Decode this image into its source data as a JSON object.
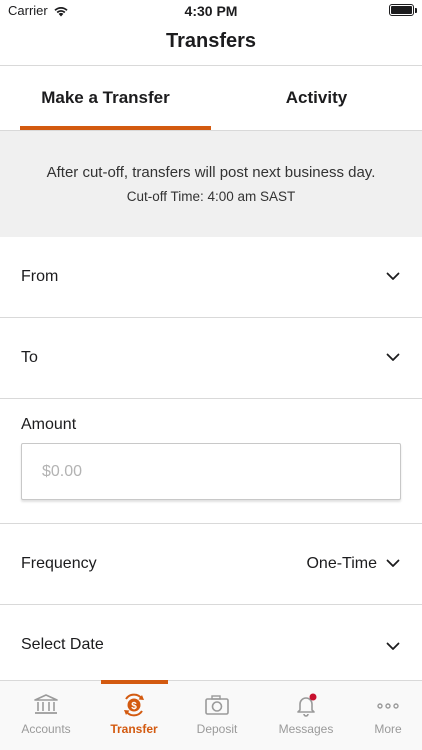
{
  "status_bar": {
    "carrier": "Carrier",
    "time": "4:30 PM"
  },
  "nav": {
    "title": "Transfers"
  },
  "tabs": [
    {
      "label": "Make a Transfer",
      "selected": true
    },
    {
      "label": "Activity",
      "selected": false
    }
  ],
  "notice": {
    "message": "After cut-off, transfers will post next business day.",
    "cutoff": "Cut-off Time: 4:00 am SAST"
  },
  "form": {
    "from_label": "From",
    "to_label": "To",
    "amount_label": "Amount",
    "amount_placeholder": "$0.00",
    "frequency_label": "Frequency",
    "frequency_value": "One-Time",
    "date_label": "Select Date"
  },
  "bottom_nav": [
    {
      "label": "Accounts",
      "icon": "bank-icon",
      "active": false
    },
    {
      "label": "Transfer",
      "icon": "transfer-dollar-icon",
      "active": true
    },
    {
      "label": "Deposit",
      "icon": "camera-icon",
      "active": false
    },
    {
      "label": "Messages",
      "icon": "bell-icon",
      "active": false,
      "badge": true
    },
    {
      "label": "More",
      "icon": "more-dots-icon",
      "active": false
    }
  ],
  "colors": {
    "accent": "#d35a10",
    "notice_bg": "#f0f0f0",
    "inactive": "#9a9a9a",
    "badge": "#c8102e"
  }
}
